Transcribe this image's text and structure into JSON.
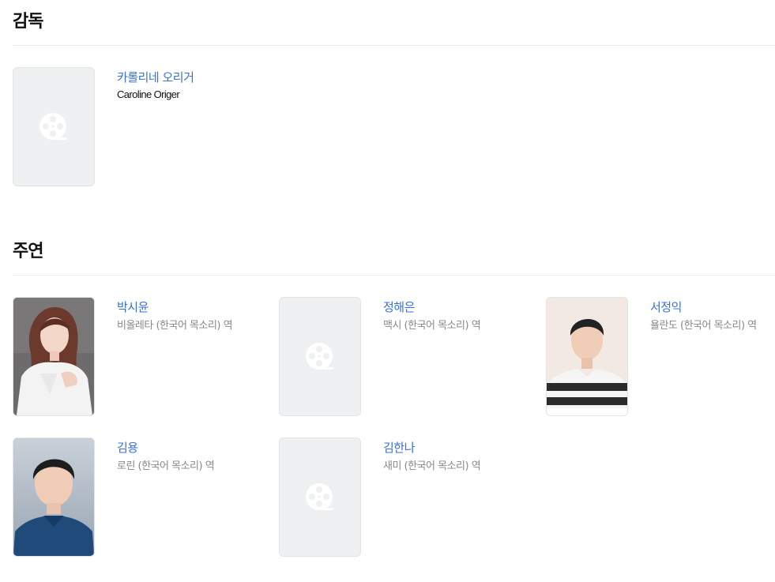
{
  "director_section": {
    "title": "감독",
    "people": [
      {
        "name": "카롤리네 오리거",
        "name_en": "Caroline Origer",
        "photo": "film-reel-icon"
      }
    ]
  },
  "cast_section": {
    "title": "주연",
    "people": [
      {
        "name": "박시윤",
        "role": "비올레타 (한국어 목소리) 역",
        "photo": "portrait-woman-long-hair"
      },
      {
        "name": "정해은",
        "role": "맥시 (한국어 목소리) 역",
        "photo": "film-reel-icon"
      },
      {
        "name": "서정익",
        "role": "욜란도 (한국어 목소리) 역",
        "photo": "portrait-man-striped-shirt"
      },
      {
        "name": "김용",
        "role": "로린 (한국어 목소리) 역",
        "photo": "portrait-man-blue-shirt"
      },
      {
        "name": "김한나",
        "role": "새미 (한국어 목소리) 역",
        "photo": "film-reel-icon"
      }
    ]
  },
  "colors": {
    "name_link": "#3a6fd8",
    "role_text": "#888888",
    "placeholder_bg": "#eef0f2",
    "divider": "#ececec"
  }
}
